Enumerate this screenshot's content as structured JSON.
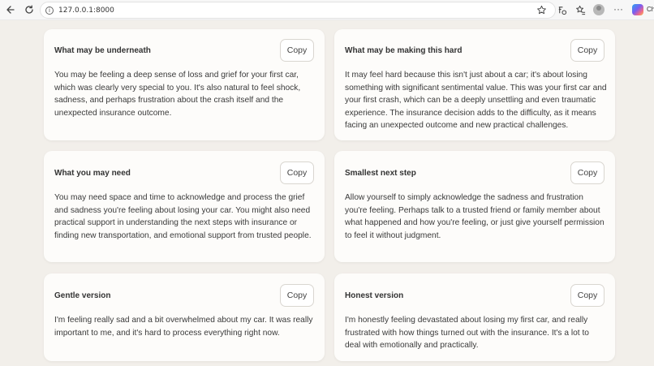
{
  "browser": {
    "url": "127.0.0.1:8000",
    "copilot_label": "Ch"
  },
  "cards": [
    {
      "title": "What may be underneath",
      "copy_label": "Copy",
      "body": "You may be feeling a deep sense of loss and grief for your first car, which was clearly very special to you. It's also natural to feel shock, sadness, and perhaps frustration about the crash itself and the unexpected insurance outcome."
    },
    {
      "title": "What may be making this hard",
      "copy_label": "Copy",
      "body": "It may feel hard because this isn't just about a car; it's about losing something with significant sentimental value. This was your first car and your first crash, which can be a deeply unsettling and even traumatic experience. The insurance decision adds to the difficulty, as it means facing an unexpected outcome and new practical challenges."
    },
    {
      "title": "What you may need",
      "copy_label": "Copy",
      "body": "You may need space and time to acknowledge and process the grief and sadness you're feeling about losing your car. You might also need practical support in understanding the next steps with insurance or finding new transportation, and emotional support from trusted people."
    },
    {
      "title": "Smallest next step",
      "copy_label": "Copy",
      "body": "Allow yourself to simply acknowledge the sadness and frustration you're feeling. Perhaps talk to a trusted friend or family member about what happened and how you're feeling, or just give yourself permission to feel it without judgment."
    },
    {
      "title": "Gentle version",
      "copy_label": "Copy",
      "body": "I'm feeling really sad and a bit overwhelmed about my car. It was really important to me, and it's hard to process everything right now."
    },
    {
      "title": "Honest version",
      "copy_label": "Copy",
      "body": "I'm honestly feeling devastated about losing my first car, and really frustrated with how things turned out with the insurance. It's a lot to deal with emotionally and practically."
    }
  ]
}
